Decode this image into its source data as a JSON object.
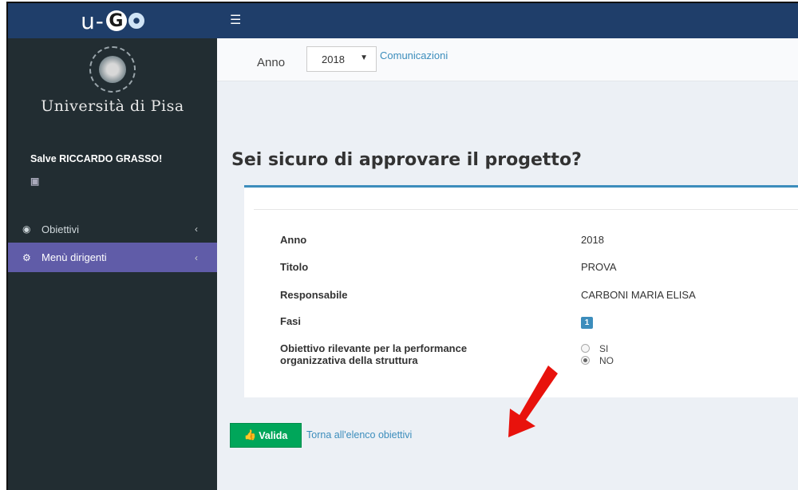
{
  "app": {
    "logo_text": "u-G",
    "university_name": "Università di Pisa",
    "greeting": "Salve RICCARDO GRASSO!"
  },
  "sidebar": {
    "items": [
      {
        "label": "Obiettivi",
        "icon": "target-icon",
        "active": false
      },
      {
        "label": "Menù dirigenti",
        "icon": "dashboard-icon",
        "active": true
      }
    ]
  },
  "filter": {
    "anno_label": "Anno",
    "anno_selected": "2018",
    "comunicazioni_link": "Comunicazioni"
  },
  "page": {
    "title": "Sei sicuro di approvare il progetto?"
  },
  "details": {
    "anno": {
      "label": "Anno",
      "value": "2018"
    },
    "titolo": {
      "label": "Titolo",
      "value": "PROVA"
    },
    "responsabile": {
      "label": "Responsabile",
      "value": "CARBONI MARIA ELISA"
    },
    "fasi": {
      "label": "Fasi",
      "value": "1"
    },
    "obiettivo": {
      "label": "Obiettivo rilevante per la performance organizzativa della struttura",
      "options": [
        {
          "label": "SI",
          "selected": false
        },
        {
          "label": "NO",
          "selected": true
        }
      ]
    }
  },
  "actions": {
    "valida_label": "Valida",
    "back_label": "Torna all'elenco obiettivi"
  },
  "colors": {
    "header": "#1f3e6a",
    "sidebar": "#222d32",
    "active_menu": "#605ca8",
    "primary": "#3c8dbc",
    "success": "#00a65a",
    "annotation_red": "#e8120c",
    "annotation_blue": "#8fb0e0"
  }
}
